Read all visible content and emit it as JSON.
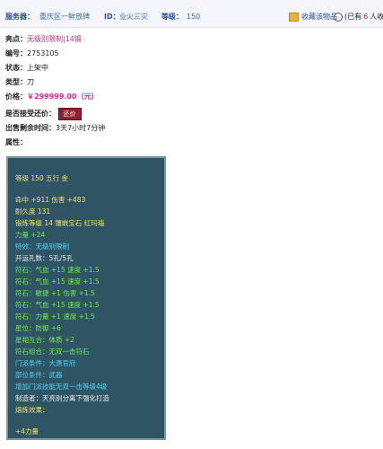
{
  "header": {
    "server_label": "服务器：",
    "server_value": "重庆区一鲜放碑",
    "id_label": "ID：",
    "id_value": "业火三灾",
    "level_label": "等级：",
    "level_value": "150",
    "favorite_button": "收藏该物品",
    "owner_prefix": "(已有",
    "owner_count": "6",
    "owner_suffix": "人收藏)"
  },
  "details": {
    "highlight_label": "亮点：",
    "highlight_value": "无级别限制|14锻",
    "id_label": "编号：",
    "id_value": "2753105",
    "status_label": "状态：",
    "status_value": "上架中",
    "type_label": "类型：",
    "type_value": "刀",
    "price_label": "价格：",
    "price_value": "￥299999.00（元）",
    "counter_label": "是否接受还价：",
    "counter_button": "还价",
    "time_label": "出售剩余时间：",
    "time_value": "3天7小时7分钟",
    "attr_label": "属性："
  },
  "attributes": {
    "line1": "等级 150  五行 金",
    "line2": "命中 +911 伤害 +483",
    "line3": "耐久度 131",
    "line4": "锻炼等级 14  镶嵌宝石 红玛瑙",
    "line5": "力量 +24",
    "line6": "特效：无级别限制",
    "line7": "开运孔数：5孔/5孔",
    "line8": "符石：气血 +15 速度 +1.5",
    "line9": "符石：气血 +15 速度 +1.5",
    "line10": "符石：敏捷 +1 伤害 +1.5",
    "line11": "符石：气血 +15 速度 +1.5",
    "line12": "符石：力量 +1 速度 +1.5",
    "line13": "星位：防御 +6",
    "line14": "星相互合：体质 +2",
    "line15": "符石组合：无双一击符石",
    "line16": "门派条件：大唐官府",
    "line17": "部位条件：武器",
    "line18": "增加门派技能无双一击等级4级",
    "line19": "制造者：天亮别分离下强化打造",
    "line20": "熔炼效果：",
    "line21": "+4力量"
  },
  "colors": {
    "panel_bg": "#2f5564",
    "price": "#e0269a",
    "button_bg": "#8e1f2c",
    "attr_yellow": "#f0e46a",
    "attr_green": "#6ee84a",
    "attr_cyan": "#4fd0f5"
  },
  "icons": {
    "favorite": "folder-star-icon",
    "owner": "user-circle-icon"
  }
}
